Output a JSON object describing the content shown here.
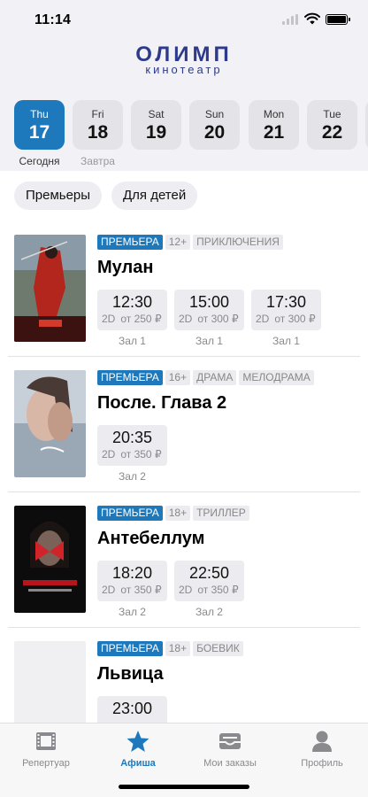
{
  "status_bar": {
    "time": "11:14"
  },
  "brand": {
    "name": "ОЛИМП",
    "subtitle": "кинотеатр"
  },
  "dates": [
    {
      "dow": "Thu",
      "day": "17",
      "caption": "Сегодня",
      "selected": true
    },
    {
      "dow": "Fri",
      "day": "18",
      "caption": "Завтра",
      "selected": false
    },
    {
      "dow": "Sat",
      "day": "19",
      "caption": "",
      "selected": false
    },
    {
      "dow": "Sun",
      "day": "20",
      "caption": "",
      "selected": false
    },
    {
      "dow": "Mon",
      "day": "21",
      "caption": "",
      "selected": false
    },
    {
      "dow": "Tue",
      "day": "22",
      "caption": "",
      "selected": false
    }
  ],
  "filters": [
    "Премьеры",
    "Для детей"
  ],
  "movies": [
    {
      "title": "Мулан",
      "tags": [
        "ПРЕМЬЕРА",
        "12+",
        "ПРИКЛЮЧЕНИЯ"
      ],
      "sessions": [
        {
          "time": "12:30",
          "format": "2D",
          "price": "от 250 ₽",
          "hall": "Зал 1"
        },
        {
          "time": "15:00",
          "format": "2D",
          "price": "от 300 ₽",
          "hall": "Зал 1"
        },
        {
          "time": "17:30",
          "format": "2D",
          "price": "от 300 ₽",
          "hall": "Зал 1"
        }
      ]
    },
    {
      "title": "После. Глава 2",
      "tags": [
        "ПРЕМЬЕРА",
        "16+",
        "ДРАМА",
        "МЕЛОДРАМА"
      ],
      "sessions": [
        {
          "time": "20:35",
          "format": "2D",
          "price": "от 350 ₽",
          "hall": "Зал 2"
        }
      ]
    },
    {
      "title": "Антебеллум",
      "tags": [
        "ПРЕМЬЕРА",
        "18+",
        "ТРИЛЛЕР"
      ],
      "sessions": [
        {
          "time": "18:20",
          "format": "2D",
          "price": "от 350 ₽",
          "hall": "Зал 2"
        },
        {
          "time": "22:50",
          "format": "2D",
          "price": "от 350 ₽",
          "hall": "Зал 2"
        }
      ]
    },
    {
      "title": "Львица",
      "tags": [
        "ПРЕМЬЕРА",
        "18+",
        "БОЕВИК"
      ],
      "sessions": [
        {
          "time": "23:00",
          "format": "",
          "price": "",
          "hall": ""
        }
      ]
    }
  ],
  "tabbar": [
    {
      "label": "Репертуар",
      "icon": "film-icon",
      "active": false
    },
    {
      "label": "Афиша",
      "icon": "star-icon",
      "active": true
    },
    {
      "label": "Мои заказы",
      "icon": "tray-icon",
      "active": false
    },
    {
      "label": "Профиль",
      "icon": "person-icon",
      "active": false
    }
  ],
  "colors": {
    "accent": "#1d79bb",
    "brand": "#2d3a8c",
    "header_bg": "#f2f2f6"
  }
}
